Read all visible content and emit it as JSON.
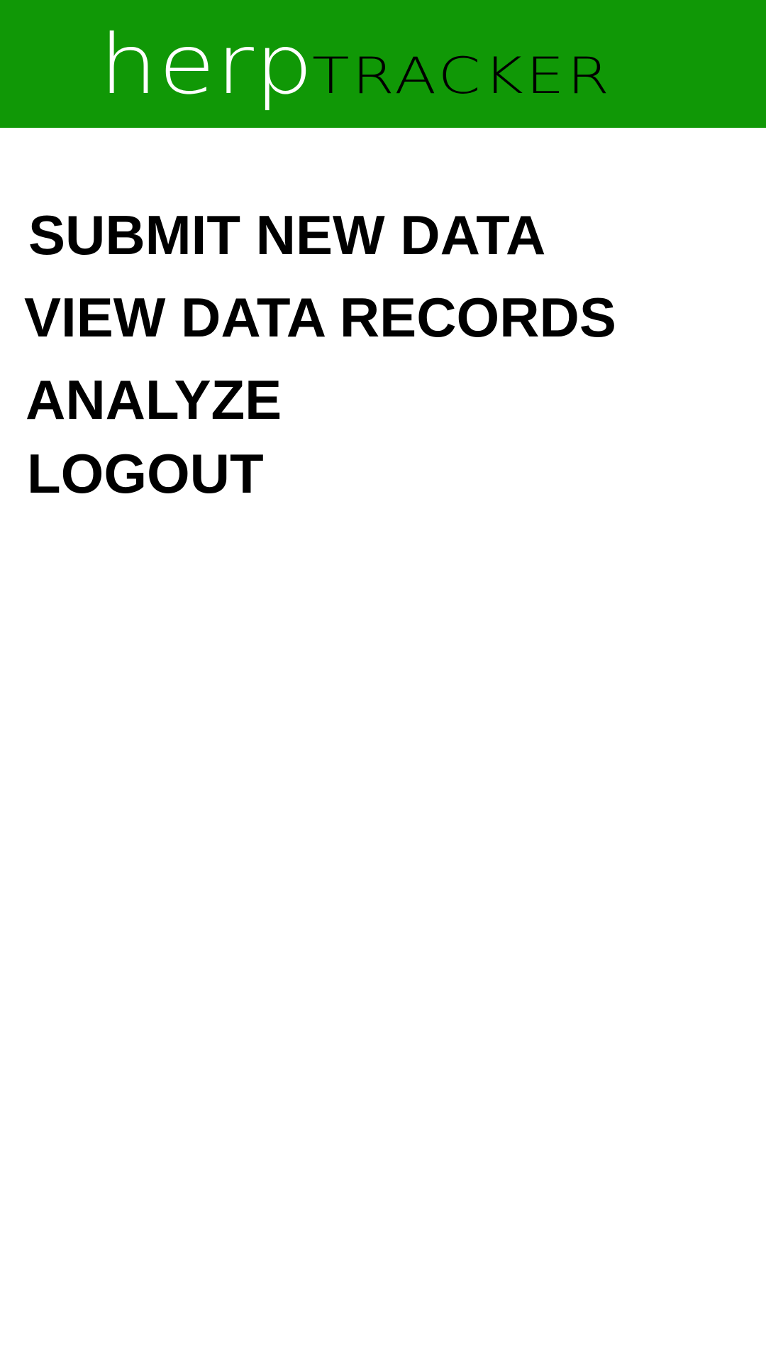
{
  "header": {
    "logo_part_1": "herp",
    "logo_part_2": "TRACKER",
    "background_color": "#109806"
  },
  "menu": {
    "items": [
      {
        "label": "SUBMIT NEW DATA"
      },
      {
        "label": "VIEW DATA RECORDS"
      },
      {
        "label": "ANALYZE"
      },
      {
        "label": "LOGOUT"
      }
    ]
  }
}
